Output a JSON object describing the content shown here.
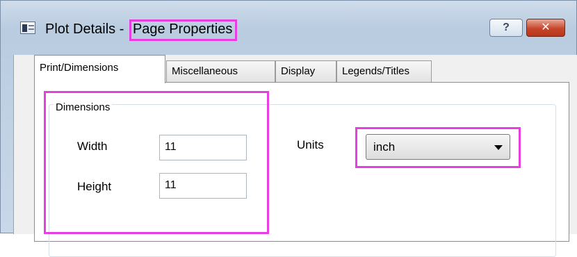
{
  "window": {
    "title_prefix": "Plot Details - ",
    "title_highlight": "Page Properties",
    "help_label": "?",
    "close_label": "✕"
  },
  "tabs": [
    {
      "label": "Print/Dimensions",
      "active": true
    },
    {
      "label": "Miscellaneous",
      "active": false
    },
    {
      "label": "Display",
      "active": false
    },
    {
      "label": "Legends/Titles",
      "active": false
    }
  ],
  "dimensions": {
    "group_label": "Dimensions",
    "width_label": "Width",
    "width_value": "11",
    "height_label": "Height",
    "height_value": "11"
  },
  "units": {
    "label": "Units",
    "selected": "inch"
  },
  "colors": {
    "highlight": "#e83de0",
    "close_button": "#c6462b"
  }
}
